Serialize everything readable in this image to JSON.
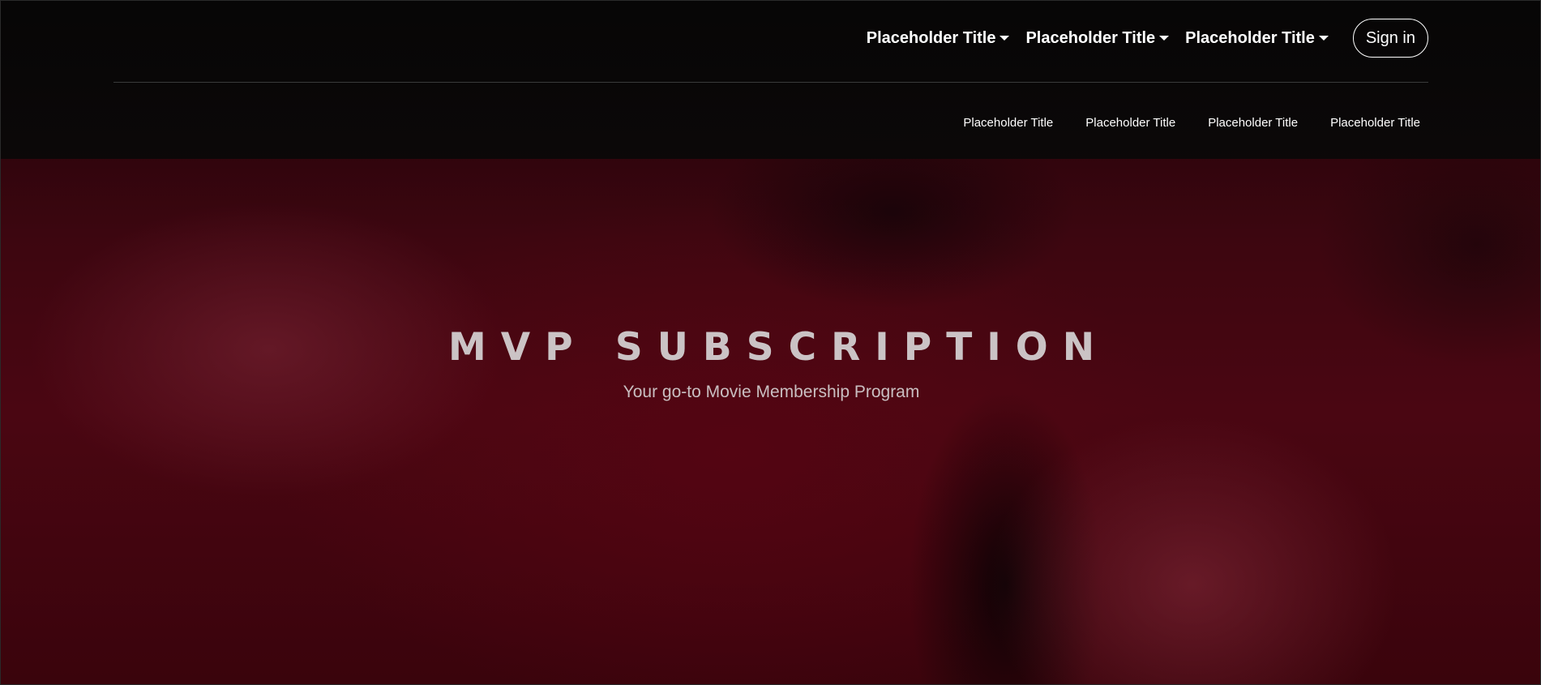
{
  "header": {
    "top_nav": [
      {
        "label": "Placeholder Title",
        "icon": "caret-down-icon"
      },
      {
        "label": "Placeholder Title",
        "icon": "caret-down-icon"
      },
      {
        "label": "Placeholder Title",
        "icon": "caret-down-icon"
      }
    ],
    "sign_in_label": "Sign in",
    "sub_nav": [
      {
        "label": "Placeholder Title"
      },
      {
        "label": "Placeholder Title"
      },
      {
        "label": "Placeholder Title"
      },
      {
        "label": "Placeholder Title"
      }
    ]
  },
  "hero": {
    "title": "MVP SUBSCRIPTION",
    "subtitle": "Your go-to Movie Membership Program"
  },
  "colors": {
    "header_bg": "#070707",
    "hero_bg": "#4a0612",
    "title_text": "#cbc3c5",
    "nav_text": "#ffffff"
  }
}
